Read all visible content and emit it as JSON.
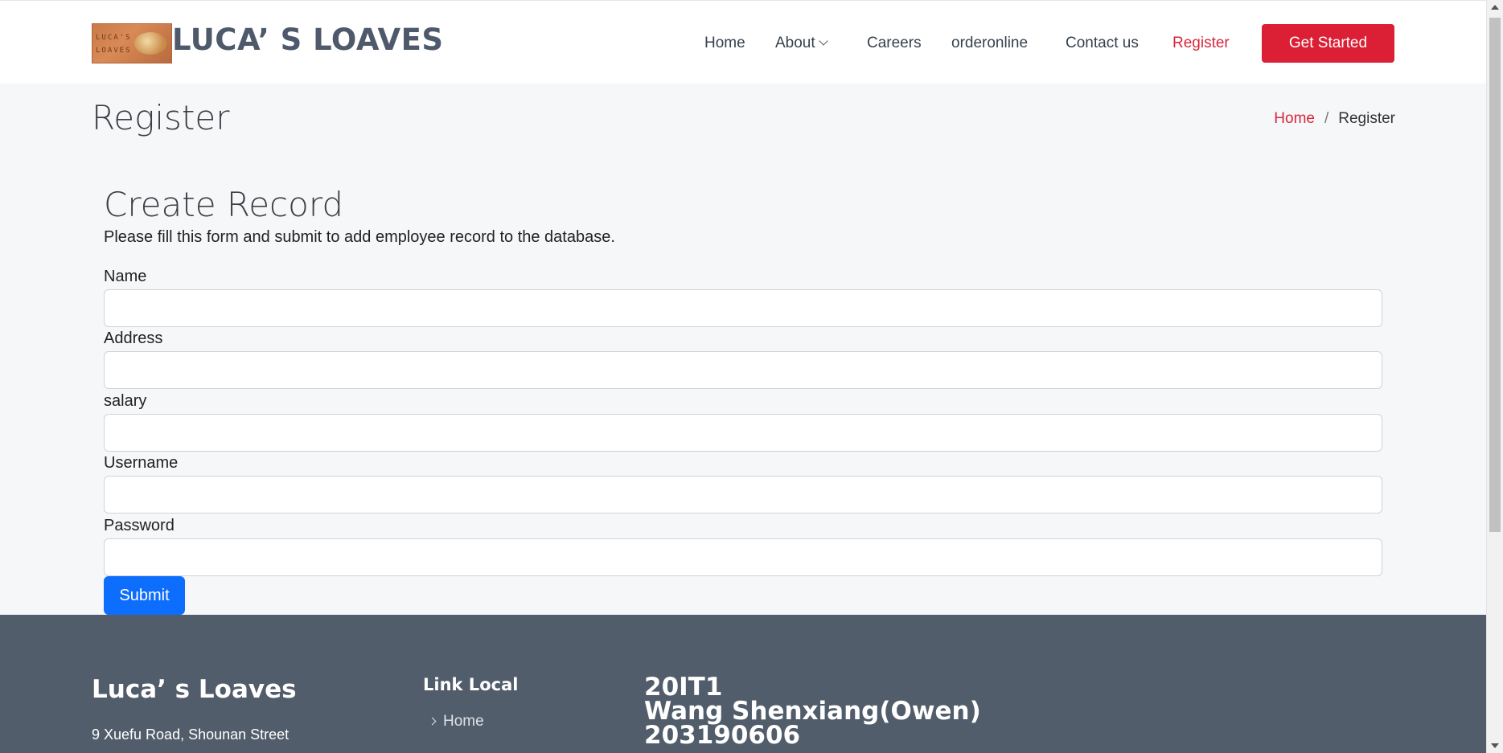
{
  "header": {
    "logo_text_line1": "LUCA'S",
    "logo_text_line2": "LOAVES",
    "brand": "LUCA’ S LOAVES",
    "nav": [
      "Home",
      "About",
      "Careers",
      "orderonline",
      "Contact us",
      "Register"
    ],
    "active_nav": "Register",
    "cta": "Get Started"
  },
  "page": {
    "title": "Register",
    "breadcrumb": {
      "home": "Home",
      "separator": "/",
      "current": "Register"
    }
  },
  "form": {
    "title": "Create Record",
    "description": "Please fill this form and submit to add employee record to the database.",
    "fields": [
      {
        "label": "Name",
        "value": ""
      },
      {
        "label": "Address",
        "value": ""
      },
      {
        "label": "salary",
        "value": ""
      },
      {
        "label": "Username",
        "value": ""
      },
      {
        "label": "Password",
        "value": ""
      }
    ],
    "submit": "Submit"
  },
  "footer": {
    "brand": "Luca’ s Loaves",
    "address": "9 Xuefu Road, Shounan Street",
    "links_title": "Link Local",
    "links": [
      "Home"
    ],
    "info": [
      "20IT1",
      "Wang Shenxiang(Owen)",
      "203190606"
    ]
  },
  "colors": {
    "accent": "#d7263d",
    "cta": "#db1f34",
    "submit": "#0d6efd",
    "footer": "#525d6b",
    "brand": "#4e5a6b"
  }
}
